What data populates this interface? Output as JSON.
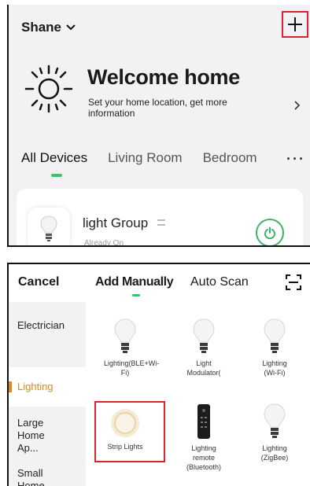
{
  "home": {
    "name": "Shane",
    "welcome_title": "Welcome home",
    "welcome_subtitle": "Set your home location, get more information",
    "tabs": [
      "All Devices",
      "Living Room",
      "Bedroom"
    ],
    "more": "···"
  },
  "device": {
    "name": "light Group",
    "status": "Already On"
  },
  "add_device": {
    "cancel": "Cancel",
    "tabs": [
      "Add Manually",
      "Auto Scan"
    ],
    "categories": [
      "Electrician",
      "Lighting",
      "Large Home Ap...",
      "Small Home Ap..."
    ],
    "items": [
      "Lighting(BLE+Wi-Fi)",
      "Light Modulator(",
      "Lighting (Wi-Fi)",
      "Strip Lights",
      "Lighting remote (Bluetooth)",
      "Lighting (ZigBee)"
    ]
  },
  "colors": {
    "accent_green": "#36c36a",
    "highlight_red": "#d9262c",
    "category_active": "#e08a1e"
  },
  "icons": [
    "chevron-down-icon",
    "plus-icon",
    "sun-icon",
    "chevron-right-icon",
    "more-dots-icon",
    "bulb-icon",
    "power-icon",
    "scan-icon",
    "strip-light-icon",
    "remote-icon"
  ]
}
